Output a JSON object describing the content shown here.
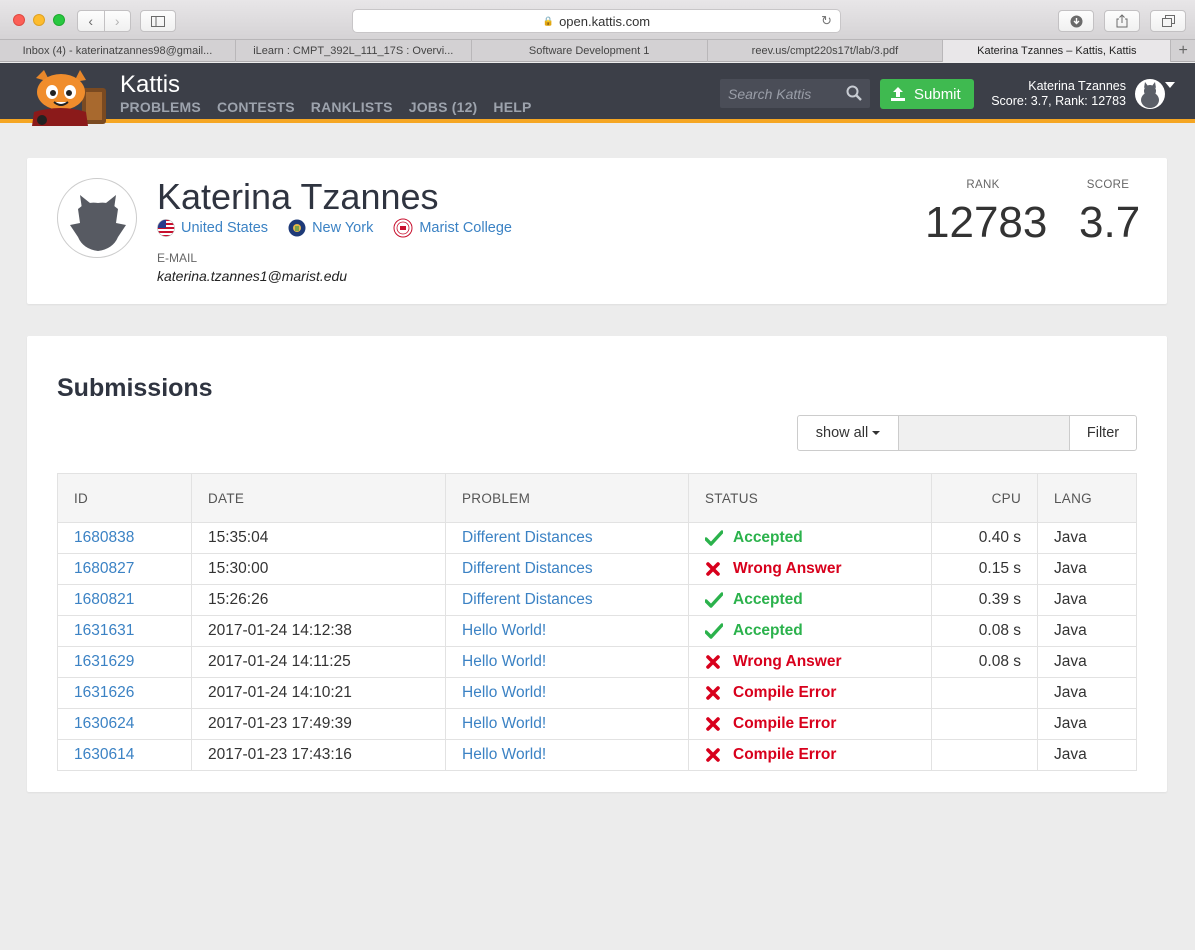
{
  "browser": {
    "url": "open.kattis.com",
    "tabs": [
      {
        "label": "Inbox (4) - katerinatzannes98@gmail...",
        "active": false
      },
      {
        "label": "iLearn : CMPT_392L_111_17S : Overvi...",
        "active": false
      },
      {
        "label": "Software Development 1",
        "active": false
      },
      {
        "label": "reev.us/cmpt220s17t/lab/3.pdf",
        "active": false
      },
      {
        "label": "Katerina Tzannes – Kattis, Kattis",
        "active": true
      }
    ]
  },
  "header": {
    "brand": "Kattis",
    "nav": [
      "PROBLEMS",
      "CONTESTS",
      "RANKLISTS",
      "JOBS (12)",
      "HELP"
    ],
    "search_placeholder": "Search Kattis",
    "submit_label": "Submit",
    "user_name": "Katerina Tzannes",
    "user_stats": "Score: 3.7, Rank: 12783"
  },
  "profile": {
    "name": "Katerina Tzannes",
    "country": "United States",
    "state": "New York",
    "school": "Marist College",
    "email_label": "E-MAIL",
    "email": "katerina.tzannes1@marist.edu",
    "rank_label": "RANK",
    "rank": "12783",
    "score_label": "SCORE",
    "score": "3.7"
  },
  "submissions": {
    "title": "Submissions",
    "filter_select": "show all",
    "filter_button": "Filter",
    "columns": {
      "id": "ID",
      "date": "DATE",
      "problem": "PROBLEM",
      "status": "STATUS",
      "cpu": "CPU",
      "lang": "LANG"
    },
    "rows": [
      {
        "id": "1680838",
        "date": "15:35:04",
        "problem": "Different Distances",
        "status": "Accepted",
        "ok": true,
        "cpu": "0.40 s",
        "lang": "Java"
      },
      {
        "id": "1680827",
        "date": "15:30:00",
        "problem": "Different Distances",
        "status": "Wrong Answer",
        "ok": false,
        "cpu": "0.15 s",
        "lang": "Java"
      },
      {
        "id": "1680821",
        "date": "15:26:26",
        "problem": "Different Distances",
        "status": "Accepted",
        "ok": true,
        "cpu": "0.39 s",
        "lang": "Java"
      },
      {
        "id": "1631631",
        "date": "2017-01-24 14:12:38",
        "problem": "Hello World!",
        "status": "Accepted",
        "ok": true,
        "cpu": "0.08 s",
        "lang": "Java"
      },
      {
        "id": "1631629",
        "date": "2017-01-24 14:11:25",
        "problem": "Hello World!",
        "status": "Wrong Answer",
        "ok": false,
        "cpu": "0.08 s",
        "lang": "Java"
      },
      {
        "id": "1631626",
        "date": "2017-01-24 14:10:21",
        "problem": "Hello World!",
        "status": "Compile Error",
        "ok": false,
        "cpu": "",
        "lang": "Java"
      },
      {
        "id": "1630624",
        "date": "2017-01-23 17:49:39",
        "problem": "Hello World!",
        "status": "Compile Error",
        "ok": false,
        "cpu": "",
        "lang": "Java"
      },
      {
        "id": "1630614",
        "date": "2017-01-23 17:43:16",
        "problem": "Hello World!",
        "status": "Compile Error",
        "ok": false,
        "cpu": "",
        "lang": "Java"
      }
    ]
  },
  "colors": {
    "accent": "#f5a623",
    "header_bg": "#3c3f48",
    "link": "#3b82c4",
    "success": "#2bb24c",
    "error": "#d8001c"
  }
}
